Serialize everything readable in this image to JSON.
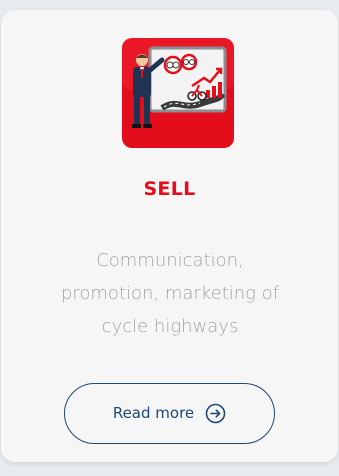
{
  "card": {
    "illustration_icon": "presenter-board-icon",
    "title": "SELL",
    "description_lines": [
      "Communication,",
      "promotion, marketing of",
      "cycle highways"
    ],
    "read_more_label": "Read more",
    "read_more_icon": "arrow-right-circle-icon"
  },
  "colors": {
    "accent": "#e30d1c",
    "button": "#1f4873",
    "description": "#a4a4a4",
    "card_background": "#f6f6f7"
  }
}
